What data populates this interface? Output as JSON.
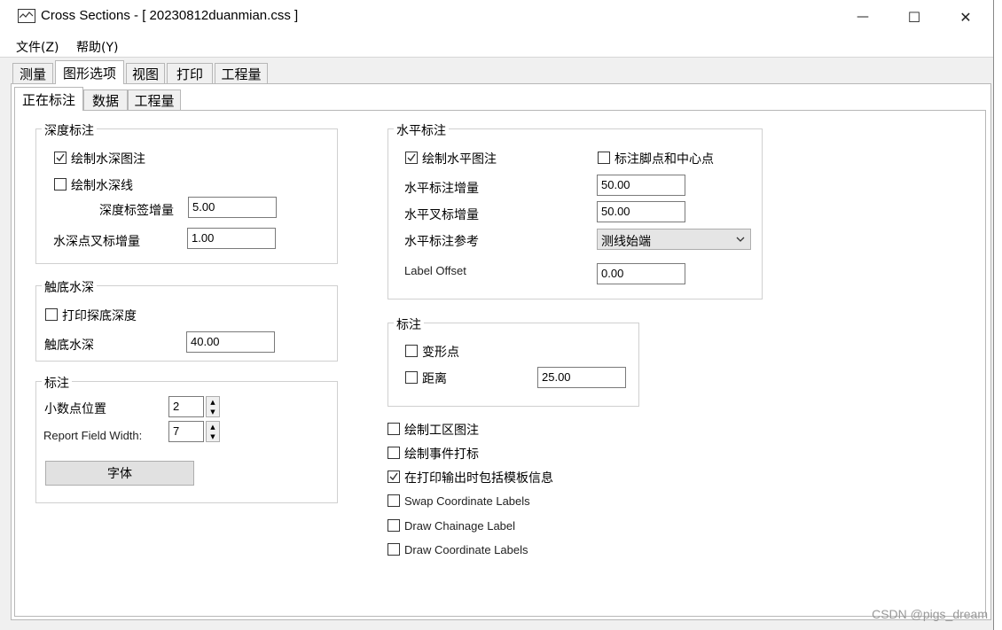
{
  "window": {
    "title": "Cross Sections - [ 20230812duanmian.css ]",
    "minimize_glyph": "—",
    "maximize_glyph": "☐",
    "close_glyph": "✕"
  },
  "menu": [
    "文件(Z)",
    "帮助(Y)"
  ],
  "tabs": [
    "测量",
    "图形选项",
    "视图",
    "打印",
    "工程量"
  ],
  "subtabs": [
    "正在标注",
    "数据",
    "工程量"
  ],
  "depth_group": {
    "title": "深度标注",
    "draw_depth_note": {
      "label": "绘制水深图注",
      "checked": true
    },
    "draw_depth_line": {
      "label": "绘制水深线",
      "checked": false
    },
    "label_increment": {
      "label": "深度标签增量",
      "value": "5.00"
    },
    "cross_increment": {
      "label": "水深点叉标增量",
      "value": "1.00"
    }
  },
  "bottom_group": {
    "title": "触底水深",
    "print_depth": {
      "label": "打印探底深度",
      "checked": false
    },
    "depth": {
      "label": "触底水深",
      "value": "40.00"
    }
  },
  "annot_group": {
    "title": "标注",
    "decimals": {
      "label": "小数点位置",
      "value": "2"
    },
    "field_width": {
      "label": "Report Field Width:",
      "value": "7"
    },
    "font_button": "字体"
  },
  "horiz_group": {
    "title": "水平标注",
    "draw_horiz": {
      "label": "绘制水平图注",
      "checked": true
    },
    "mark_foot": {
      "label": "标注脚点和中心点",
      "checked": false
    },
    "horiz_increment": {
      "label": "水平标注增量",
      "value": "50.00"
    },
    "horiz_cross": {
      "label": "水平叉标增量",
      "value": "50.00"
    },
    "horiz_ref": {
      "label": "水平标注参考",
      "value": "测线始端"
    },
    "label_offset": {
      "label": "Label Offset",
      "value": "0.00"
    }
  },
  "mark_group": {
    "title": "标注",
    "deform": {
      "label": "变形点",
      "checked": false
    },
    "distance": {
      "label": "距离",
      "checked": false,
      "value": "25.00"
    }
  },
  "options": [
    {
      "label": "绘制工区图注",
      "checked": false
    },
    {
      "label": "绘制事件打标",
      "checked": false
    },
    {
      "label": "在打印输出时包括模板信息",
      "checked": true
    },
    {
      "label": "Swap Coordinate Labels",
      "checked": false
    },
    {
      "label": "Draw Chainage Label",
      "checked": false
    },
    {
      "label": "Draw Coordinate Labels",
      "checked": false
    }
  ],
  "watermark": "CSDN @pigs_dream"
}
